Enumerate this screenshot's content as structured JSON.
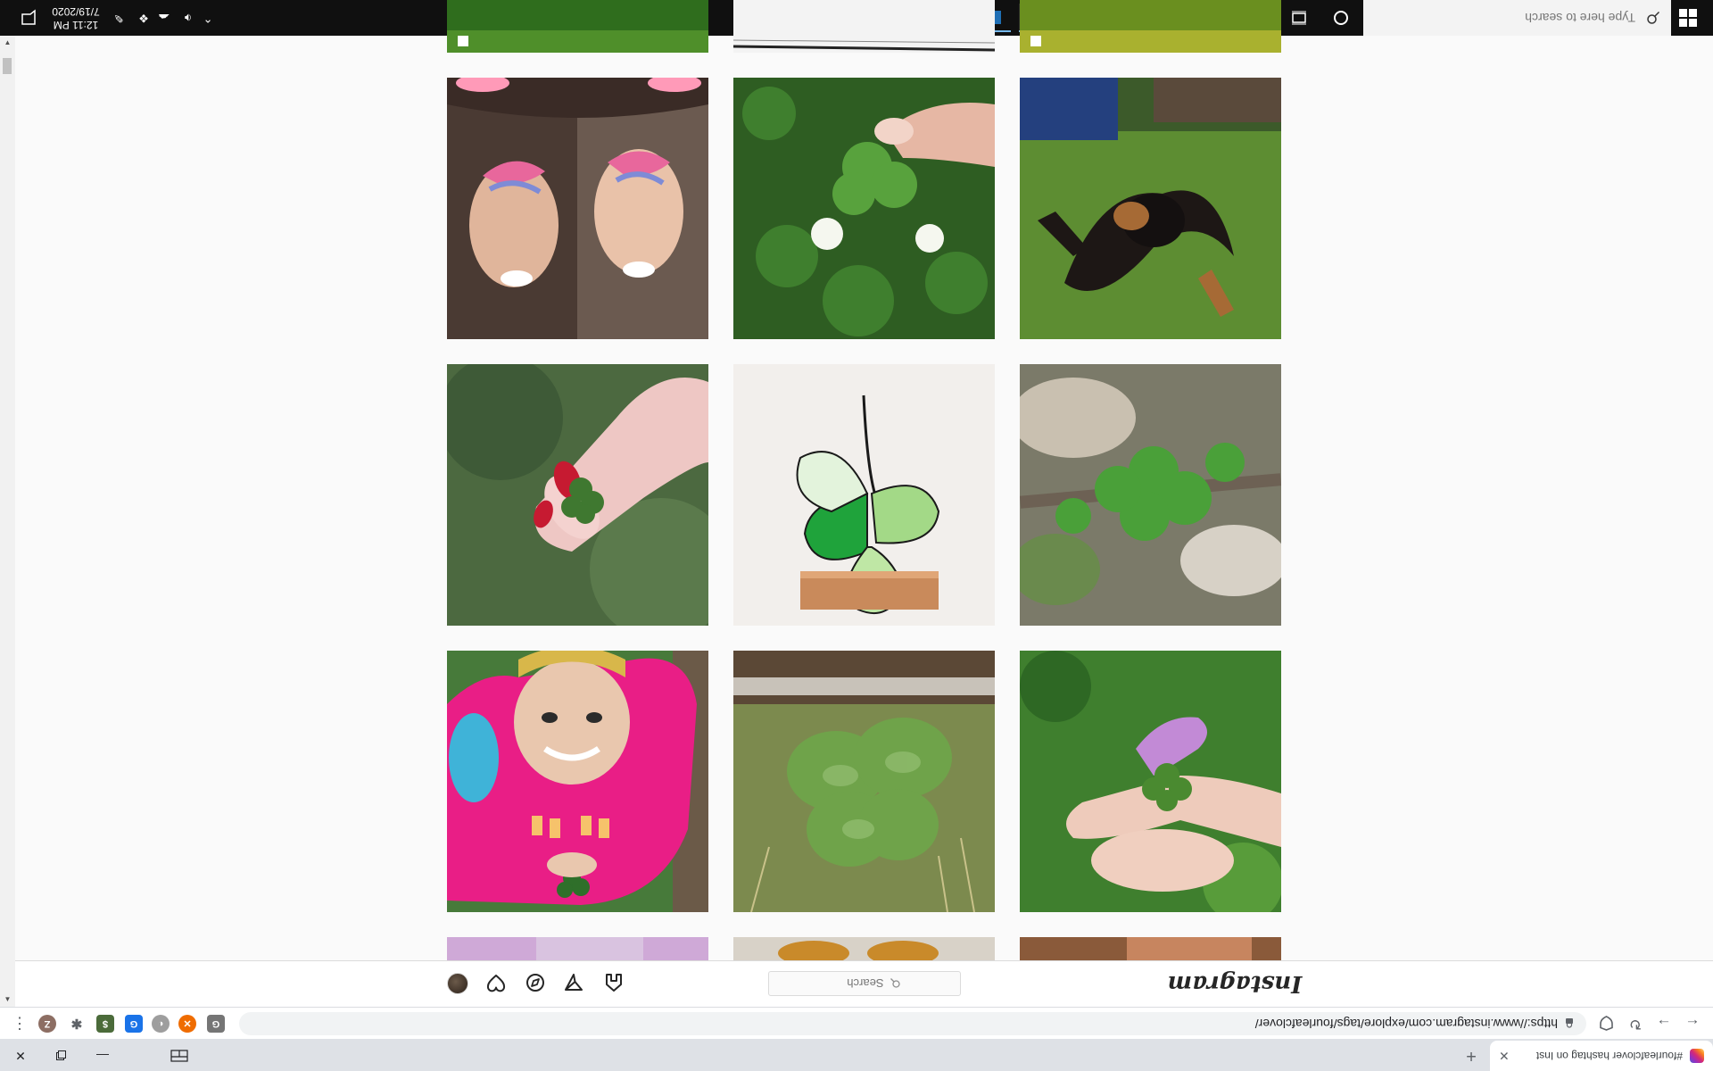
{
  "taskbar": {
    "search_placeholder": "Type here to search",
    "clock_time": "12:11 PM",
    "clock_date": "7/19/2020"
  },
  "browser": {
    "tab_title": "#fourleafclover hashtag on Inst",
    "tab_close": "✕",
    "new_tab": "+",
    "url": "https://www.instagram.com/explore/tags/fourleafclover/",
    "extensions": [
      {
        "name": "profile-avatar",
        "label": "Z",
        "color": "#8d6e63"
      },
      {
        "name": "puzzle-extension",
        "label": "✱",
        "color": "#5f6368"
      },
      {
        "name": "bank-extension",
        "label": "$",
        "color": "#4b6b3a"
      },
      {
        "name": "grammar-extension",
        "label": "G",
        "color": "#1a73e8"
      },
      {
        "name": "circle-extension",
        "label": "◐",
        "color": "#9e9e9e"
      },
      {
        "name": "x-extension",
        "label": "✕",
        "color": "#ef6c00"
      },
      {
        "name": "g-extension",
        "label": "G",
        "color": "#757575"
      }
    ]
  },
  "instagram": {
    "logo": "Instagram",
    "search_placeholder": "Search"
  },
  "grid": {
    "rows": [
      [
        "Two smiling girls with face paint",
        "Hand picking clover among white clover flowers",
        "Black and tan dog lying on grass"
      ],
      [
        "Four-leaf clover held between red-painted fingernails",
        "Stained glass four-leaf clover suncatcher on wood",
        "Clover plant growing among rocks"
      ],
      [
        "Girl in pink shirt holding four-leaf clover",
        "Close-up of large four-leaf clover",
        "Fingers holding four-leaf clover with purple flower"
      ]
    ]
  }
}
